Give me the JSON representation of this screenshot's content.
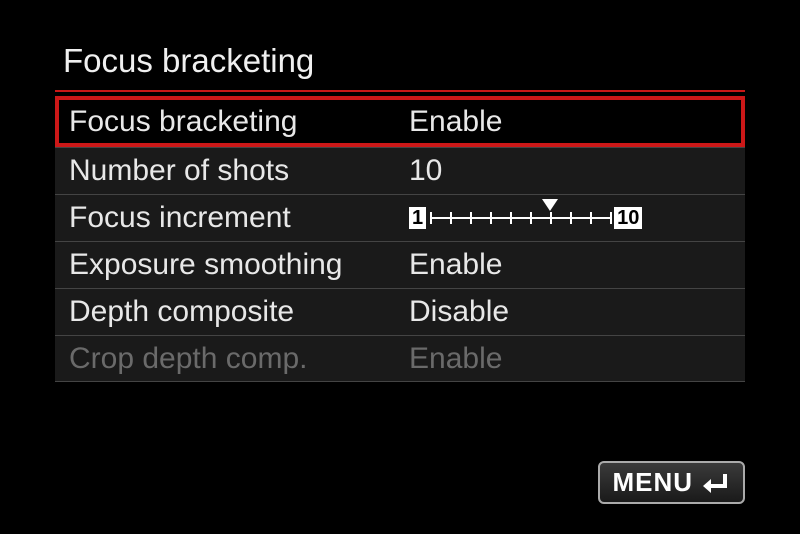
{
  "title": "Focus bracketing",
  "menu": [
    {
      "label": "Focus bracketing",
      "value": "Enable",
      "selected": true,
      "disabled": false,
      "type": "text"
    },
    {
      "label": "Number of shots",
      "value": "10",
      "selected": false,
      "disabled": false,
      "type": "text"
    },
    {
      "label": "Focus increment",
      "value": "",
      "selected": false,
      "disabled": false,
      "type": "scale",
      "scale": {
        "min": 1,
        "max": 10,
        "position": 7,
        "minLabel": "1",
        "maxLabel": "10"
      }
    },
    {
      "label": "Exposure smoothing",
      "value": "Enable",
      "selected": false,
      "disabled": false,
      "type": "text"
    },
    {
      "label": "Depth composite",
      "value": "Disable",
      "selected": false,
      "disabled": false,
      "type": "text"
    },
    {
      "label": "Crop depth comp.",
      "value": "Enable",
      "selected": false,
      "disabled": true,
      "type": "text"
    }
  ],
  "footer": {
    "menuButtonLabel": "MENU"
  }
}
